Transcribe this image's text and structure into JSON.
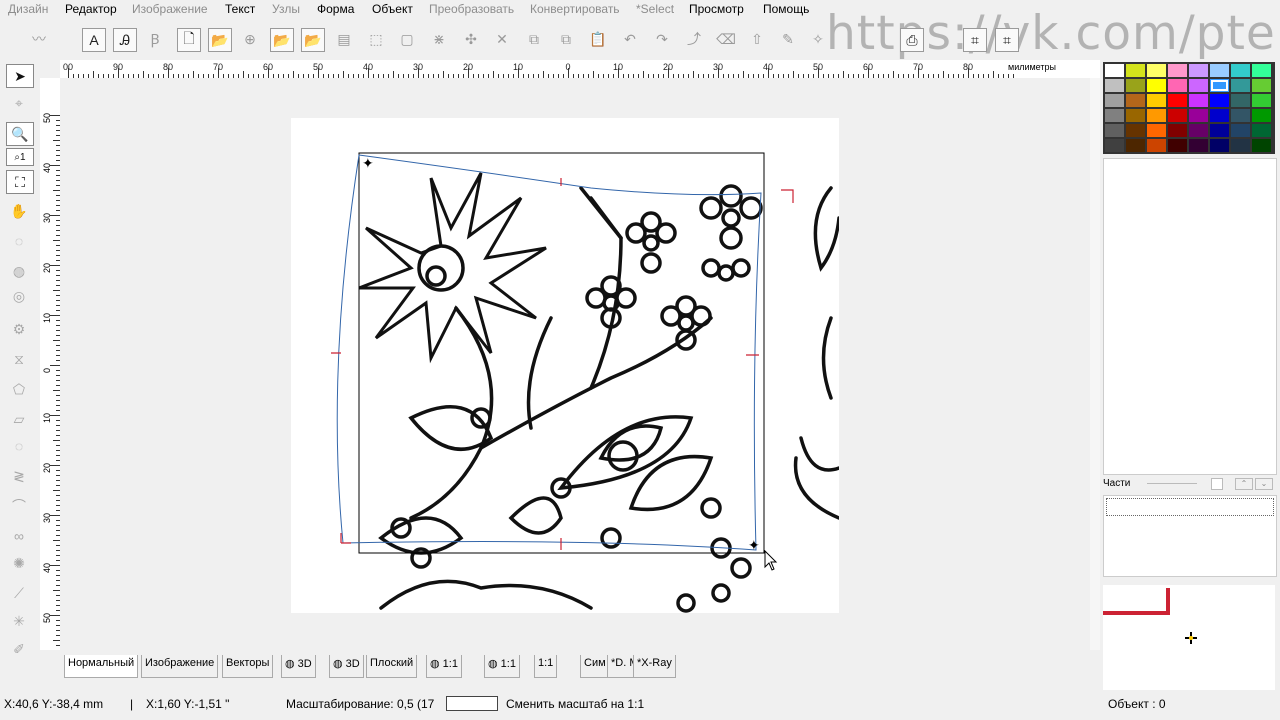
{
  "menu": [
    {
      "label": "Дизайн",
      "disabled": true
    },
    {
      "label": "Редактор",
      "disabled": false
    },
    {
      "label": "Изображение",
      "disabled": true
    },
    {
      "label": "Текст",
      "disabled": false
    },
    {
      "label": "Узлы",
      "disabled": true
    },
    {
      "label": "Форма",
      "disabled": false
    },
    {
      "label": "Объект",
      "disabled": false
    },
    {
      "label": "Преобразовать",
      "disabled": true
    },
    {
      "label": "Конвертировать",
      "disabled": true
    },
    {
      "label": "*Select",
      "disabled": true
    },
    {
      "label": "Просмотр",
      "disabled": false
    },
    {
      "label": "Помощь",
      "disabled": false
    }
  ],
  "watermark": "https://vk.com/pteris",
  "ruler": {
    "units": "милиметры",
    "h_labels": [
      "00",
      "90",
      "80",
      "70",
      "60",
      "50",
      "40",
      "30",
      "20",
      "10",
      "0",
      "10",
      "20",
      "30",
      "40",
      "50",
      "60",
      "70",
      "80"
    ],
    "v_labels": [
      "50",
      "40",
      "30",
      "20",
      "10",
      "0",
      "10",
      "20",
      "30",
      "40",
      "50"
    ]
  },
  "tabs": [
    "Нормальный",
    "Изображение",
    "Векторы",
    "3D",
    "3D",
    "Плоский",
    "1:1",
    "1:1",
    "1:1",
    "Сим",
    "*D. Map",
    "*X-Ray"
  ],
  "status": {
    "coords_mm": "X:40,6   Y:-38,4 mm",
    "sep": "|",
    "coords_in": "X:1,60   Y:-1,51 \"",
    "scale_label": "Масштабирование: 0,5 (17",
    "scale_value": "",
    "scale_btn": "Сменить масштаб на 1:1",
    "object_count": "Объект : 0"
  },
  "parts_label": "Части",
  "palette": [
    "#ffffff",
    "#d4e31c",
    "#ffff66",
    "#ff99cc",
    "#cc99ff",
    "#99ccff",
    "#33cccc",
    "#33ff99",
    "#c0c0c0",
    "#99a31a",
    "#ffff00",
    "#ff66b3",
    "#cc66ff",
    "#3399ff",
    "#339999",
    "#66cc33",
    "#a0a0a0",
    "#b3661a",
    "#ffcc00",
    "#ff0000",
    "#cc33ff",
    "#0000ff",
    "#336666",
    "#33cc33",
    "#808080",
    "#996600",
    "#ff9900",
    "#cc0000",
    "#990099",
    "#0000cc",
    "#335566",
    "#009900",
    "#606060",
    "#663300",
    "#ff6600",
    "#800000",
    "#660066",
    "#000099",
    "#224466",
    "#006633",
    "#404040",
    "#4d2600",
    "#cc4400",
    "#400000",
    "#330033",
    "#000066",
    "#223344",
    "#004400"
  ]
}
